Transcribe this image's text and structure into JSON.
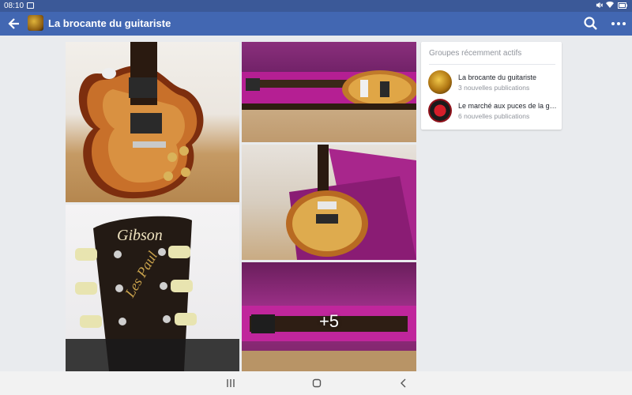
{
  "status_bar": {
    "time": "08:10"
  },
  "app_bar": {
    "title": "La brocante du guitariste"
  },
  "photos": {
    "more_count": "+5"
  },
  "sidebar_card": {
    "title": "Groupes récemment actifs",
    "groups": [
      {
        "name": "La brocante du guitariste",
        "subtitle": "3 nouvelles publications"
      },
      {
        "name": "Le marché aux puces de la guit...",
        "subtitle": "6 nouvelles publications"
      }
    ]
  },
  "colors": {
    "header": "#4267b2",
    "status": "#3b5998",
    "background": "#e9ebee"
  },
  "icons": [
    "back-arrow-icon",
    "search-icon",
    "more-options-icon",
    "recent-apps-icon",
    "home-icon",
    "nav-back-icon"
  ]
}
